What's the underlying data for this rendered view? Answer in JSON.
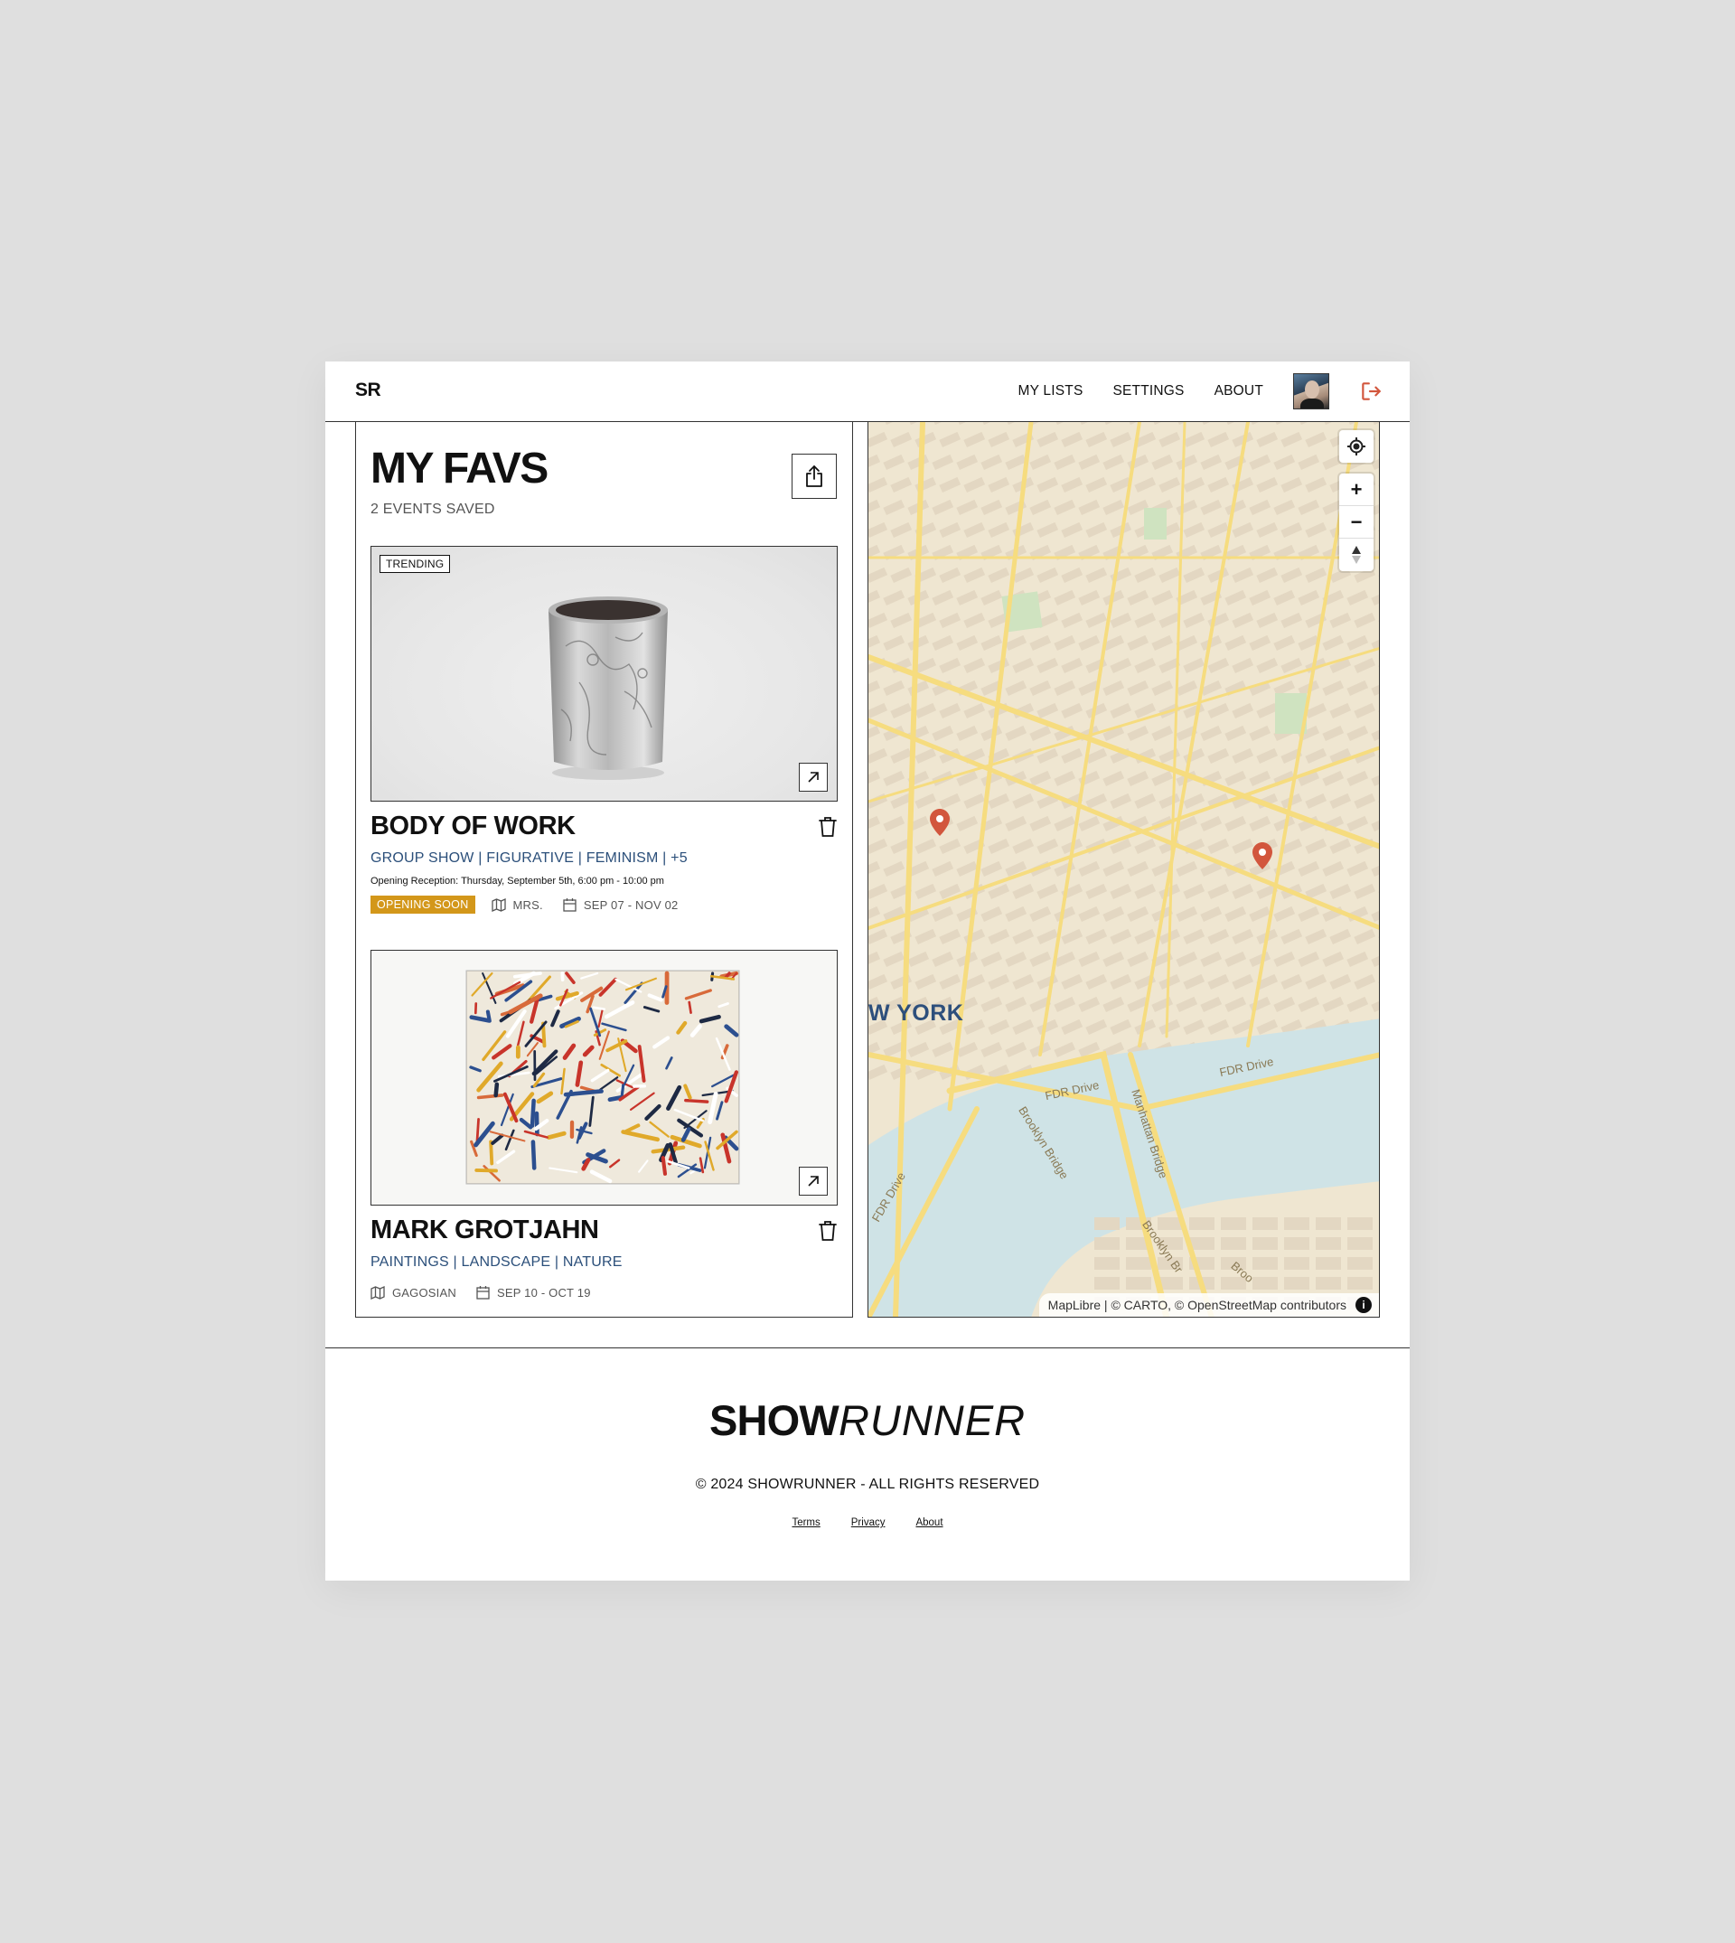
{
  "header": {
    "logo": "SR",
    "nav": [
      "MY LISTS",
      "SETTINGS",
      "ABOUT"
    ]
  },
  "list": {
    "title": "MY FAVS",
    "subtitle": "2 EVENTS SAVED"
  },
  "events": [
    {
      "badge": "TRENDING",
      "title": "BODY OF WORK",
      "tags": "GROUP SHOW | FIGURATIVE | FEMINISM | +5",
      "reception": "Opening Reception: Thursday, September 5th, 6:00 pm - 10:00 pm",
      "status": "OPENING SOON",
      "venue": "MRS.",
      "dates": "SEP 07 - NOV 02"
    },
    {
      "title": "MARK GROTJAHN",
      "tags": "PAINTINGS | LANDSCAPE | NATURE",
      "venue": "GAGOSIAN",
      "dates": "SEP 10 - OCT 19"
    }
  ],
  "map": {
    "city_label": "W YORK",
    "roads": [
      "FDR Drive",
      "FDR Drive",
      "Brooklyn Bridge",
      "Manhattan Bridge",
      "FDR Drive",
      "Brooklyn Br",
      "Broo"
    ],
    "attribution": "MapLibre | © CARTO, © OpenStreetMap contributors",
    "zoom_in": "+",
    "zoom_out": "−",
    "info_label": "i"
  },
  "footer": {
    "logo_bold": "SHOW",
    "logo_light": "RUNNER",
    "copyright": "© 2024 SHOWRUNNER - ALL RIGHTS RESERVED",
    "links": [
      "Terms",
      "Privacy",
      "About"
    ]
  },
  "colors": {
    "accent_red": "#d2563d",
    "tag_blue": "#2b4f7a",
    "status_gold": "#d3971a",
    "map_water": "#cfe3e6",
    "map_road": "#f6dc7f"
  }
}
